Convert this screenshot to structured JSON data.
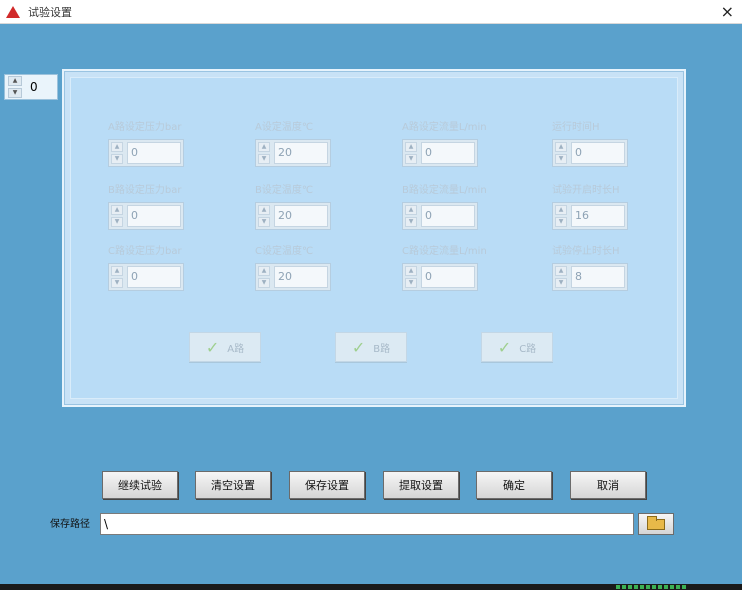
{
  "window": {
    "title": "试验设置",
    "close_symbol": "×"
  },
  "index_spinner": {
    "value": "0"
  },
  "fields": [
    {
      "label": "A路设定压力bar",
      "value": "0"
    },
    {
      "label": "A设定温度℃",
      "value": "20"
    },
    {
      "label": "A路设定流量L/min",
      "value": "0"
    },
    {
      "label": "运行时间H",
      "value": "0"
    },
    {
      "label": "B路设定压力bar",
      "value": "0"
    },
    {
      "label": "B设定温度℃",
      "value": "20"
    },
    {
      "label": "B路设定流量L/min",
      "value": "0"
    },
    {
      "label": "试验开启时长H",
      "value": "16"
    },
    {
      "label": "C路设定压力bar",
      "value": "0"
    },
    {
      "label": "C设定温度℃",
      "value": "20"
    },
    {
      "label": "C路设定流量L/min",
      "value": "0"
    },
    {
      "label": "试验停止时长H",
      "value": "8"
    }
  ],
  "path_buttons": [
    {
      "label": "A路"
    },
    {
      "label": "B路"
    },
    {
      "label": "C路"
    }
  ],
  "buttons": [
    {
      "label": "继续试验"
    },
    {
      "label": "清空设置"
    },
    {
      "label": "保存设置"
    },
    {
      "label": "提取设置"
    },
    {
      "label": "确定"
    },
    {
      "label": "取消"
    }
  ],
  "save_path": {
    "label": "保存路径",
    "value": "\\"
  }
}
